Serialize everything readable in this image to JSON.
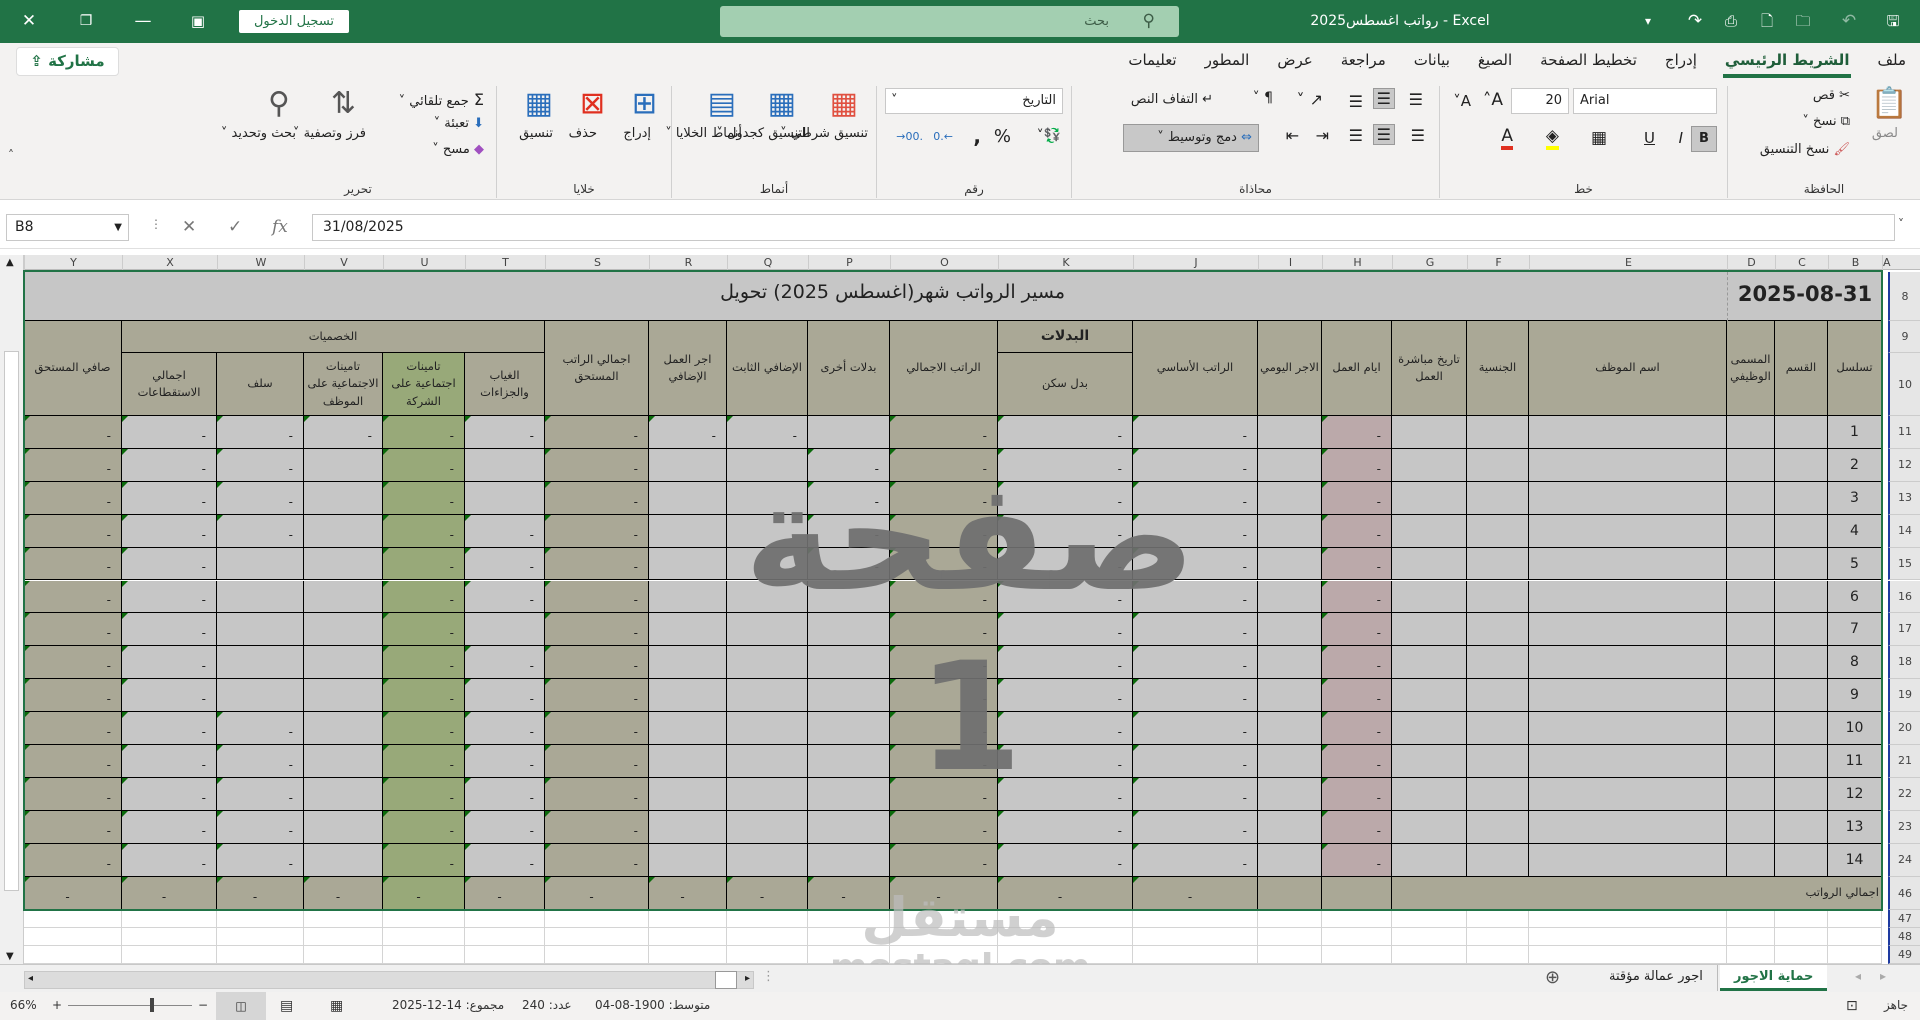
{
  "title_bar": {
    "app_title": "رواتب اغسطس2025  -  Excel",
    "search_placeholder": "بحث",
    "sign_in": "تسجيل الدخول"
  },
  "ribbon_tabs": {
    "items": [
      "ملف",
      "الشريط الرئيسي",
      "إدراج",
      "تخطيط الصفحة",
      "الصيغ",
      "بيانات",
      "مراجعة",
      "عرض",
      "المطور",
      "تعليمات"
    ],
    "active_index": 1,
    "share": "مشاركة"
  },
  "ribbon": {
    "clipboard": {
      "label": "الحافظة",
      "paste": "لصق",
      "cut": "قص",
      "copy": "نسخ",
      "format_painter": "نسخ التنسيق"
    },
    "font": {
      "label": "خط",
      "font_name": "Arial",
      "font_size": "20",
      "bold": "B",
      "italic": "I",
      "underline": "U"
    },
    "alignment": {
      "label": "محاذاة",
      "wrap_text": "التفاف النص",
      "merge_center": "دمج وتوسيط"
    },
    "number": {
      "label": "رقم",
      "format": "التاريخ"
    },
    "styles": {
      "label": "أنماط",
      "conditional": "تنسيق شرطي",
      "as_table": "التنسيق كجدول",
      "cell_styles": "أنماط الخلايا"
    },
    "cells": {
      "label": "خلايا",
      "insert": "إدراج",
      "delete": "حذف",
      "format": "تنسيق"
    },
    "editing": {
      "label": "تحرير",
      "autosum": "جمع تلقائي",
      "fill": "تعبئة",
      "clear": "مسح",
      "sort_filter": "فرز وتصفية",
      "find_select": "بحث وتحديد"
    }
  },
  "formula_bar": {
    "name_box": "B8",
    "value": "31/08/2025",
    "fx": "fx"
  },
  "sheet": {
    "column_letters": [
      "Y",
      "X",
      "W",
      "V",
      "U",
      "T",
      "S",
      "R",
      "Q",
      "P",
      "O",
      "K",
      "J",
      "I",
      "H",
      "G",
      "F",
      "E",
      "D",
      "C",
      "B",
      "A"
    ],
    "row_numbers": [
      "8",
      "9",
      "10",
      "11",
      "12",
      "13",
      "14",
      "15",
      "16",
      "17",
      "18",
      "19",
      "20",
      "21",
      "22",
      "23",
      "24",
      "46",
      "47",
      "48",
      "49"
    ],
    "title_date": "2025-08-31",
    "title_text": "مسير الرواتب شهر(اغسطس 2025)  تحويل بنكي",
    "headers": {
      "Y": "صافي المستحق",
      "deductions_group": "الخصميات",
      "X": "اجمالي الاستقطاعات",
      "W": "سلف",
      "V": "تامينات الاجتماعية على الموظف",
      "U": "تامينات اجتماعية على الشركة",
      "T": "الغياب والجزاءات",
      "S": "اجمالي الراتب المستحق",
      "R": "اجر العمل الإضافي",
      "Q": "الإضافي الثابت",
      "P": "بدلات أخرى",
      "O": "الراتب الاجمالي",
      "allowances_group": "البدلات",
      "K": "بدل سكن",
      "J": "الراتب الأساسي",
      "I": "الاجر اليومي",
      "H": "ايام العمل",
      "G": "تاريخ مباشرة العمل",
      "F": "الجنسية",
      "E": "اسم الموظف",
      "D": "المسمى الوظيفي",
      "C": "القسم",
      "B": "تسلسل"
    },
    "value_columns": [
      "Y",
      "X",
      "W",
      "V",
      "U",
      "T",
      "S",
      "R",
      "Q",
      "P",
      "O",
      "K",
      "J",
      "I",
      "H"
    ],
    "rows": [
      {
        "serial": "1",
        "values": [
          "-",
          "-",
          "-",
          "-",
          "-",
          "-",
          "-",
          "-",
          "-",
          "",
          "-",
          "-",
          "-",
          "",
          "-"
        ]
      },
      {
        "serial": "2",
        "values": [
          "-",
          "-",
          "-",
          "",
          "-",
          "",
          "-",
          "",
          "",
          "-",
          "-",
          "-",
          "-",
          "",
          "-"
        ]
      },
      {
        "serial": "3",
        "values": [
          "-",
          "-",
          "-",
          "",
          "-",
          "",
          "-",
          "",
          "",
          "-",
          "-",
          "-",
          "-",
          "",
          "-"
        ]
      },
      {
        "serial": "4",
        "values": [
          "-",
          "-",
          "-",
          "",
          "-",
          "-",
          "-",
          "",
          "",
          "-",
          "-",
          "-",
          "-",
          "",
          "-"
        ]
      },
      {
        "serial": "5",
        "values": [
          "-",
          "-",
          "",
          "",
          "-",
          "-",
          "-",
          "",
          "",
          "-",
          "-",
          "-",
          "-",
          "",
          "-"
        ]
      },
      {
        "serial": "6",
        "values": [
          "-",
          "-",
          "",
          "",
          "-",
          "-",
          "-",
          "",
          "",
          "",
          "-",
          "-",
          "-",
          "",
          "-"
        ]
      },
      {
        "serial": "7",
        "values": [
          "-",
          "-",
          "",
          "",
          "-",
          "",
          "-",
          "",
          "",
          "",
          "-",
          "-",
          "-",
          "",
          "-"
        ]
      },
      {
        "serial": "8",
        "values": [
          "-",
          "-",
          "",
          "",
          "-",
          "-",
          "-",
          "",
          "",
          "",
          "-",
          "-",
          "-",
          "",
          "-"
        ]
      },
      {
        "serial": "9",
        "values": [
          "-",
          "-",
          "",
          "",
          "-",
          "-",
          "-",
          "",
          "",
          "",
          "-",
          "-",
          "-",
          "",
          "-"
        ]
      },
      {
        "serial": "10",
        "values": [
          "-",
          "-",
          "-",
          "",
          "-",
          "-",
          "-",
          "",
          "",
          "",
          "-",
          "-",
          "-",
          "",
          "-"
        ]
      },
      {
        "serial": "11",
        "values": [
          "-",
          "-",
          "-",
          "",
          "-",
          "-",
          "-",
          "",
          "",
          "",
          "-",
          "-",
          "-",
          "",
          "-"
        ]
      },
      {
        "serial": "12",
        "values": [
          "-",
          "-",
          "-",
          "",
          "-",
          "-",
          "-",
          "",
          "",
          "",
          "-",
          "-",
          "-",
          "",
          "-"
        ]
      },
      {
        "serial": "13",
        "values": [
          "-",
          "-",
          "-",
          "",
          "-",
          "-",
          "-",
          "",
          "",
          "",
          "-",
          "-",
          "-",
          "",
          "-"
        ]
      },
      {
        "serial": "14",
        "values": [
          "-",
          "-",
          "-",
          "",
          "-",
          "-",
          "-",
          "",
          "",
          "",
          "-",
          "-",
          "-",
          "",
          "-"
        ]
      }
    ],
    "total": {
      "label": "اجمالي الرواتب",
      "values": [
        "-",
        "-",
        "-",
        "-",
        "-",
        "-",
        "-",
        "-",
        "-",
        "-",
        "-",
        "-",
        "-",
        "",
        ""
      ]
    },
    "watermark": "صفحة 1",
    "colors": {
      "title_bg": "#c6c6c6",
      "header_bg": "#aaa896",
      "cell_bg": "#c6c6c6",
      "tan_col": "#aaa896",
      "green_col": "#98a979",
      "pink_col": "#bba9aa",
      "excel_green": "#217346"
    }
  },
  "logo_watermark": {
    "arabic": "مستقل",
    "latin": "mostaql.com"
  },
  "sheet_tabs": {
    "items": [
      "حماية الاجور",
      "اجور عمالة مؤقتة"
    ],
    "active_index": 0
  },
  "status_bar": {
    "ready": "جاهز",
    "average": "متوسط: 1900-08-04",
    "count": "عدد: 240",
    "sum": "مجموع: 14-12-2025",
    "zoom": "66%"
  }
}
